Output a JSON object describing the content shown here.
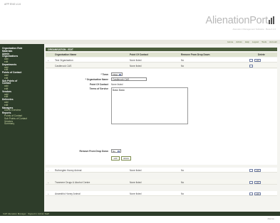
{
  "header": {
    "app_version": "APP ENG v1.6",
    "logo_text": "AlienationPort",
    "logo_tagline": "Alienation Management Software · Beta 2.1.0"
  },
  "topnav": [
    "Home",
    "Admin",
    "Help",
    "Logout",
    "Tools",
    "Account"
  ],
  "sidebar": [
    {
      "label": "Organisation Role",
      "head": true
    },
    {
      "label": "Materials",
      "head": true
    },
    {
      "label": "Admin",
      "head": true
    },
    {
      "label": "Organisations",
      "head": true
    },
    {
      "label": "add",
      "head": false
    },
    {
      "label": "edit",
      "head": false
    },
    {
      "label": "Departments",
      "head": true
    },
    {
      "label": "add",
      "head": false
    },
    {
      "label": "edit",
      "head": false
    },
    {
      "label": "Points of Contact",
      "head": true
    },
    {
      "label": "add",
      "head": false
    },
    {
      "label": "edit",
      "head": false
    },
    {
      "label": "Sub Points of",
      "head": true
    },
    {
      "label": "Contact",
      "head": true
    },
    {
      "label": "add",
      "head": false
    },
    {
      "label": "edit",
      "head": false
    },
    {
      "label": "Vendors",
      "head": true
    },
    {
      "label": "add",
      "head": false
    },
    {
      "label": "edit",
      "head": false
    },
    {
      "label": "Deliveries",
      "head": true
    },
    {
      "label": "add",
      "head": false
    },
    {
      "label": "edit",
      "head": false
    },
    {
      "label": "Managers",
      "head": true
    },
    {
      "label": "Users Overview",
      "head": false
    },
    {
      "label": "Reports",
      "head": true
    },
    {
      "label": "Points of Contact",
      "head": false
    },
    {
      "label": "Sub Points of Contact",
      "head": false
    },
    {
      "label": "Vendors",
      "head": false
    },
    {
      "label": "Summary",
      "head": false
    }
  ],
  "section_title": "ORGANISATION - EDIT",
  "table": {
    "headers": {
      "name": "Organisation Name",
      "poc": "Point Of Contact",
      "remove": "Remove From Drop Down",
      "delete": "Delete"
    },
    "rows_top": [
      {
        "expander": "+",
        "name": "Test Organisation",
        "poc": "None listed",
        "remove": "No"
      },
      {
        "expander": "",
        "name": "Castlerock CAS",
        "poc": "None listed",
        "remove": "No"
      }
    ],
    "rows_bottom": [
      {
        "expander": "+",
        "name": "Rutherglen Honey Animal",
        "poc": "None listed",
        "remove": "No"
      },
      {
        "expander": "+",
        "name": "Tranmere Drugs & Alcohol Centre",
        "poc": "None listed",
        "remove": "No"
      },
      {
        "expander": "+",
        "name": "Anaesthic Honey Animal",
        "poc": "None listed",
        "remove": "No"
      }
    ],
    "edit_btn_label": "edit"
  },
  "form": {
    "town_label": "* Town",
    "town_value": "Killarr",
    "org_name_label": "* Organisation Name",
    "org_name_value": "Castlerock CAS",
    "poc_label": "Point Of Contact",
    "poc_value": "None listed",
    "terms_label": "Terms of Service",
    "terms_value": "Basic  Basic",
    "remove_label": "Remove From Drop Down",
    "remove_value": "No",
    "edit_button": "edit",
    "delete_button": "delete"
  },
  "bottom_bar": "CAP Alienation Manager · Signed in: Admin Staff",
  "footer_right": "Alienat..."
}
